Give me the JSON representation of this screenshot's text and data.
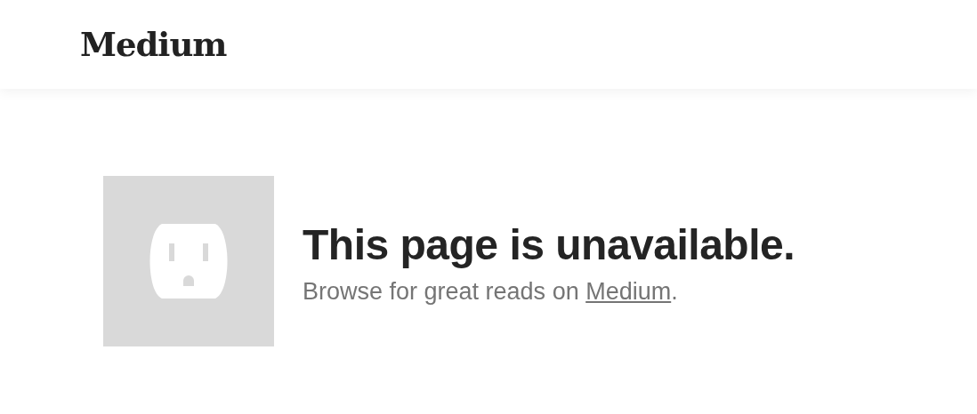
{
  "header": {
    "logo": "Medium"
  },
  "error": {
    "picture": {
      "kind": "outlet"
    },
    "title": "This page is unavailable.",
    "message": {
      "before": "Browse for great reads on ",
      "link": "Medium",
      "after": "."
    }
  }
}
